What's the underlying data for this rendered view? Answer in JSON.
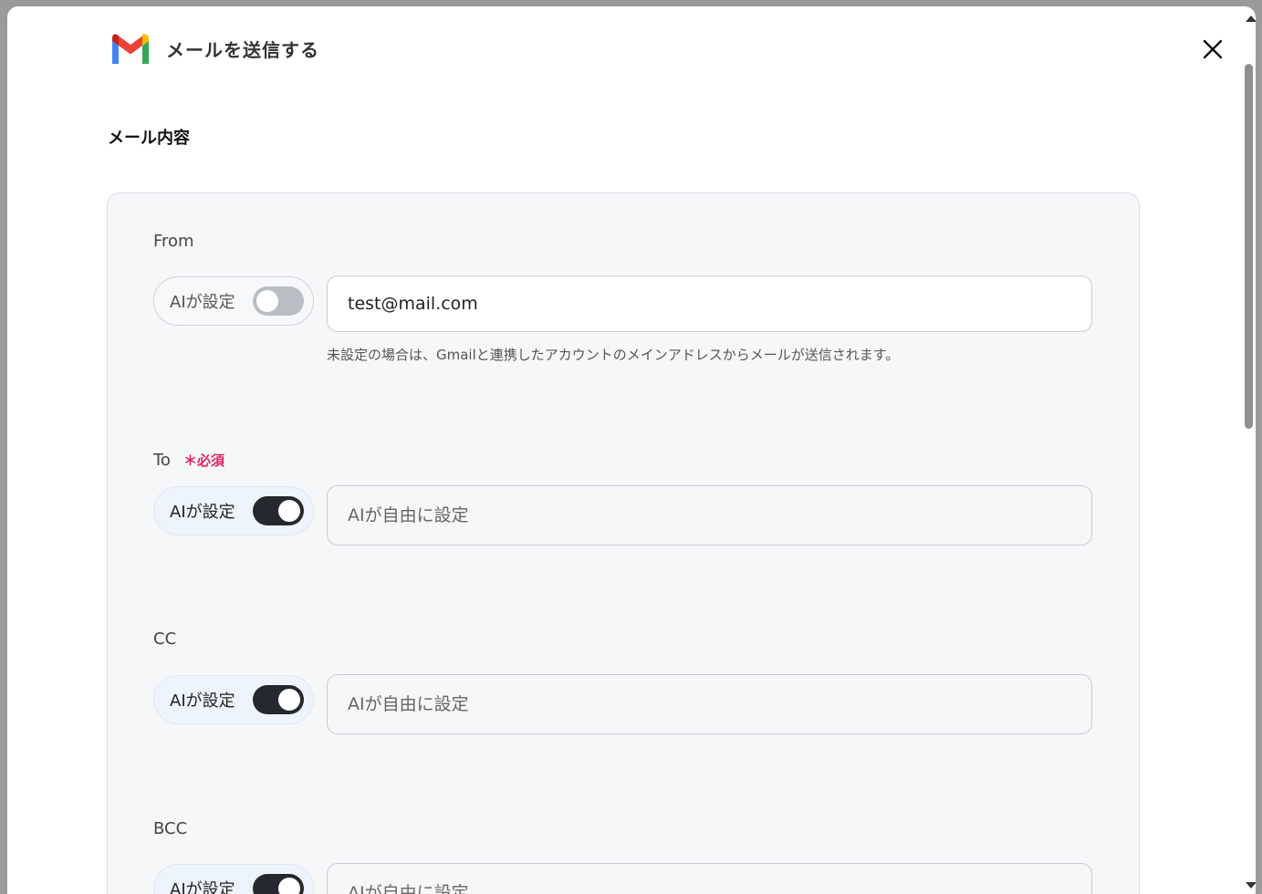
{
  "modal": {
    "title": "メールを送信する",
    "section_title": "メール内容"
  },
  "fields": {
    "from": {
      "label": "From",
      "ai_label": "AIが設定",
      "ai_enabled": false,
      "value": "test@mail.com",
      "hint": "未設定の場合は、Gmailと連携したアカウントのメインアドレスからメールが送信されます。"
    },
    "to": {
      "label": "To",
      "required_label": "＊必須",
      "ai_label": "AIが設定",
      "ai_enabled": true,
      "placeholder": "AIが自由に設定"
    },
    "cc": {
      "label": "CC",
      "ai_label": "AIが設定",
      "ai_enabled": true,
      "placeholder": "AIが自由に設定"
    },
    "bcc": {
      "label": "BCC",
      "ai_label": "AIが設定",
      "ai_enabled": true,
      "placeholder": "AIが自由に設定"
    }
  },
  "colors": {
    "required": "#e0245e",
    "switch_on": "#25282d",
    "switch_off": "#b9bec5"
  },
  "icons": {
    "brand": "gmail-icon",
    "close": "close-icon"
  }
}
